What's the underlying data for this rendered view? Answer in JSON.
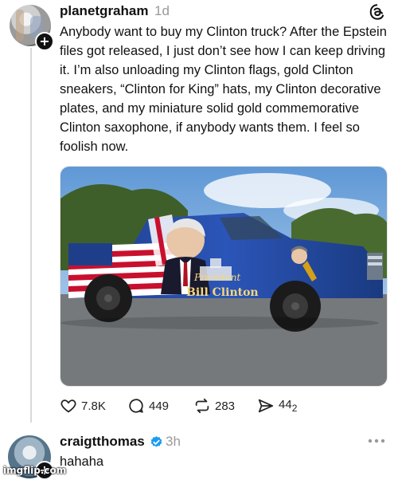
{
  "post": {
    "username": "planetgraham",
    "time": "1d",
    "text": "Anybody want to buy my Clinton truck? After the Epstein files got released, I just don’t see how I can keep driving it. I’m also unloading my Clinton flags, gold Clinton sneakers, “Clinton for King” hats, my Clinton decorative plates, and my miniature solid gold commemorative Clinton saxophone, if anybody wants them. I feel so foolish now.",
    "image_caption_line1": "President",
    "image_caption_line2": "Bill Clinton",
    "actions": {
      "likes": "7.8K",
      "comments": "449",
      "reposts": "283",
      "shares_main": "44",
      "shares_sub": "2"
    }
  },
  "reply": {
    "username": "craigtthomas",
    "time": "3h",
    "text": "hahaha"
  },
  "watermark": "imgflip.com",
  "icons": {
    "app": "threads-icon",
    "like": "heart-icon",
    "comment": "comment-icon",
    "repost": "repost-icon",
    "share": "send-icon",
    "verified": "verified-badge-icon",
    "more": "more-dots-icon",
    "follow": "plus-icon"
  },
  "colors": {
    "verified": "#1d9bf0",
    "muted": "#999999"
  }
}
